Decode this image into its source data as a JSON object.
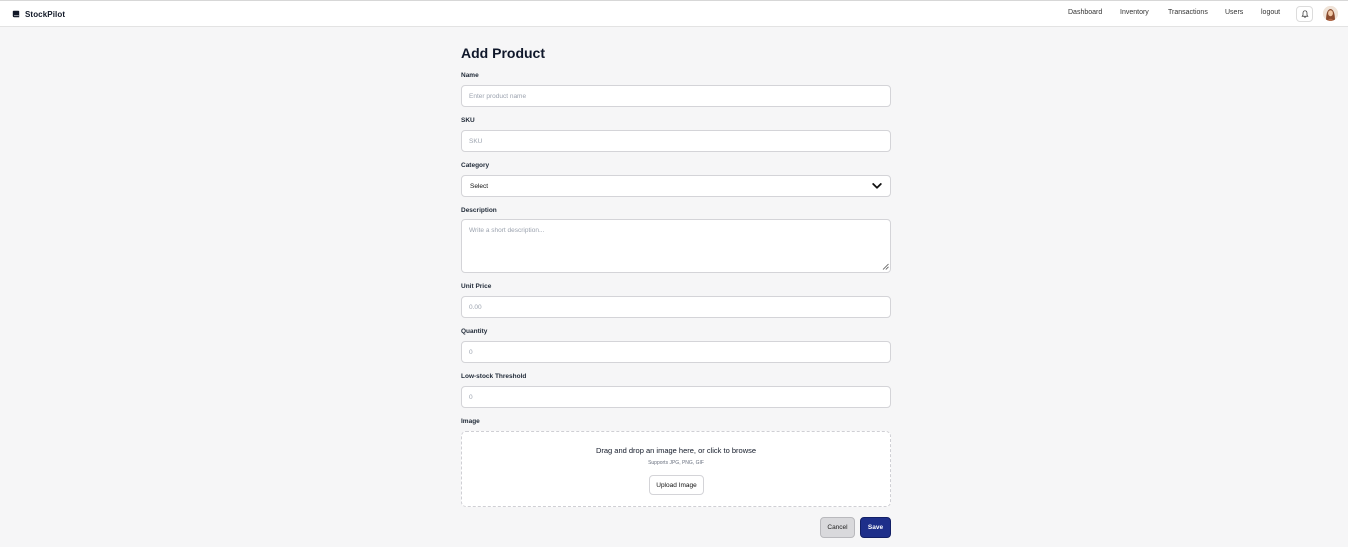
{
  "app": {
    "name": "StockPilot",
    "icon": "book-icon"
  },
  "nav": {
    "items": [
      "Dashboard",
      "Inventory",
      "Transactions",
      "Users",
      "logout"
    ],
    "notification_icon": "bell-icon",
    "avatar_icon": "user-avatar"
  },
  "form": {
    "title": "Add Product",
    "name": {
      "label": "Name",
      "placeholder": "Enter product name",
      "value": ""
    },
    "sku": {
      "label": "SKU",
      "placeholder": "SKU",
      "value": ""
    },
    "category": {
      "label": "Category",
      "selected": "Select",
      "icon": "chevron-down-icon"
    },
    "description": {
      "label": "Description",
      "placeholder": "Write a short description...",
      "value": ""
    },
    "unit_price": {
      "label": "Unit Price",
      "placeholder": "0.00",
      "value": ""
    },
    "quantity": {
      "label": "Quantity",
      "placeholder": "0",
      "value": ""
    },
    "low_stock": {
      "label": "Low-stock Threshold",
      "placeholder": "0",
      "value": ""
    },
    "image": {
      "label": "Image",
      "dropzone_text": "Drag and drop an image here, or click to browse",
      "supported": "Supports JPG, PNG, GIF",
      "upload_label": "Upload Image"
    },
    "cancel_label": "Cancel",
    "save_label": "Save"
  },
  "colors": {
    "primary": "#1e2f8a",
    "background": "#f6f6f7",
    "border": "#d4d4d8"
  }
}
